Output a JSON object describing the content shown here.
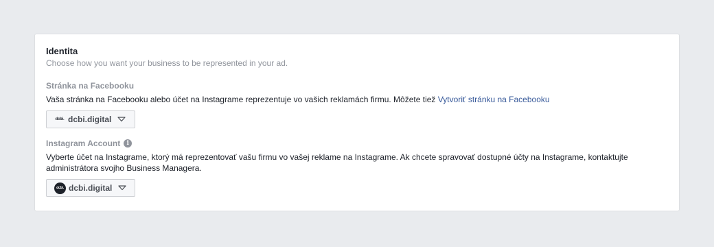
{
  "identity": {
    "title": "Identita",
    "subtitle": "Choose how you want your business to be represented in your ad."
  },
  "facebook_page": {
    "label": "Stránka na Facebooku",
    "description": "Vaša stránka na Facebooku alebo účet na Instagrame reprezentuje vo vašich reklamách firmu. Môžete tiež ",
    "link_text": "Vytvoriť stránku na Facebooku",
    "logo_text": "dcbi.",
    "selected_value": "dcbi.digital",
    "link_color": "#365899"
  },
  "instagram_account": {
    "label": "Instagram Account",
    "info_icon": "info-icon",
    "description": "Vyberte účet na Instagrame, ktorý má reprezentovať vašu firmu vo vašej reklame na Instagrame. Ak chcete spravovať dostupné účty na Instagrame, kontaktujte administrátora svojho Business Managera.",
    "avatar_text": "dcbi.",
    "selected_value": "dcbi.digital"
  }
}
